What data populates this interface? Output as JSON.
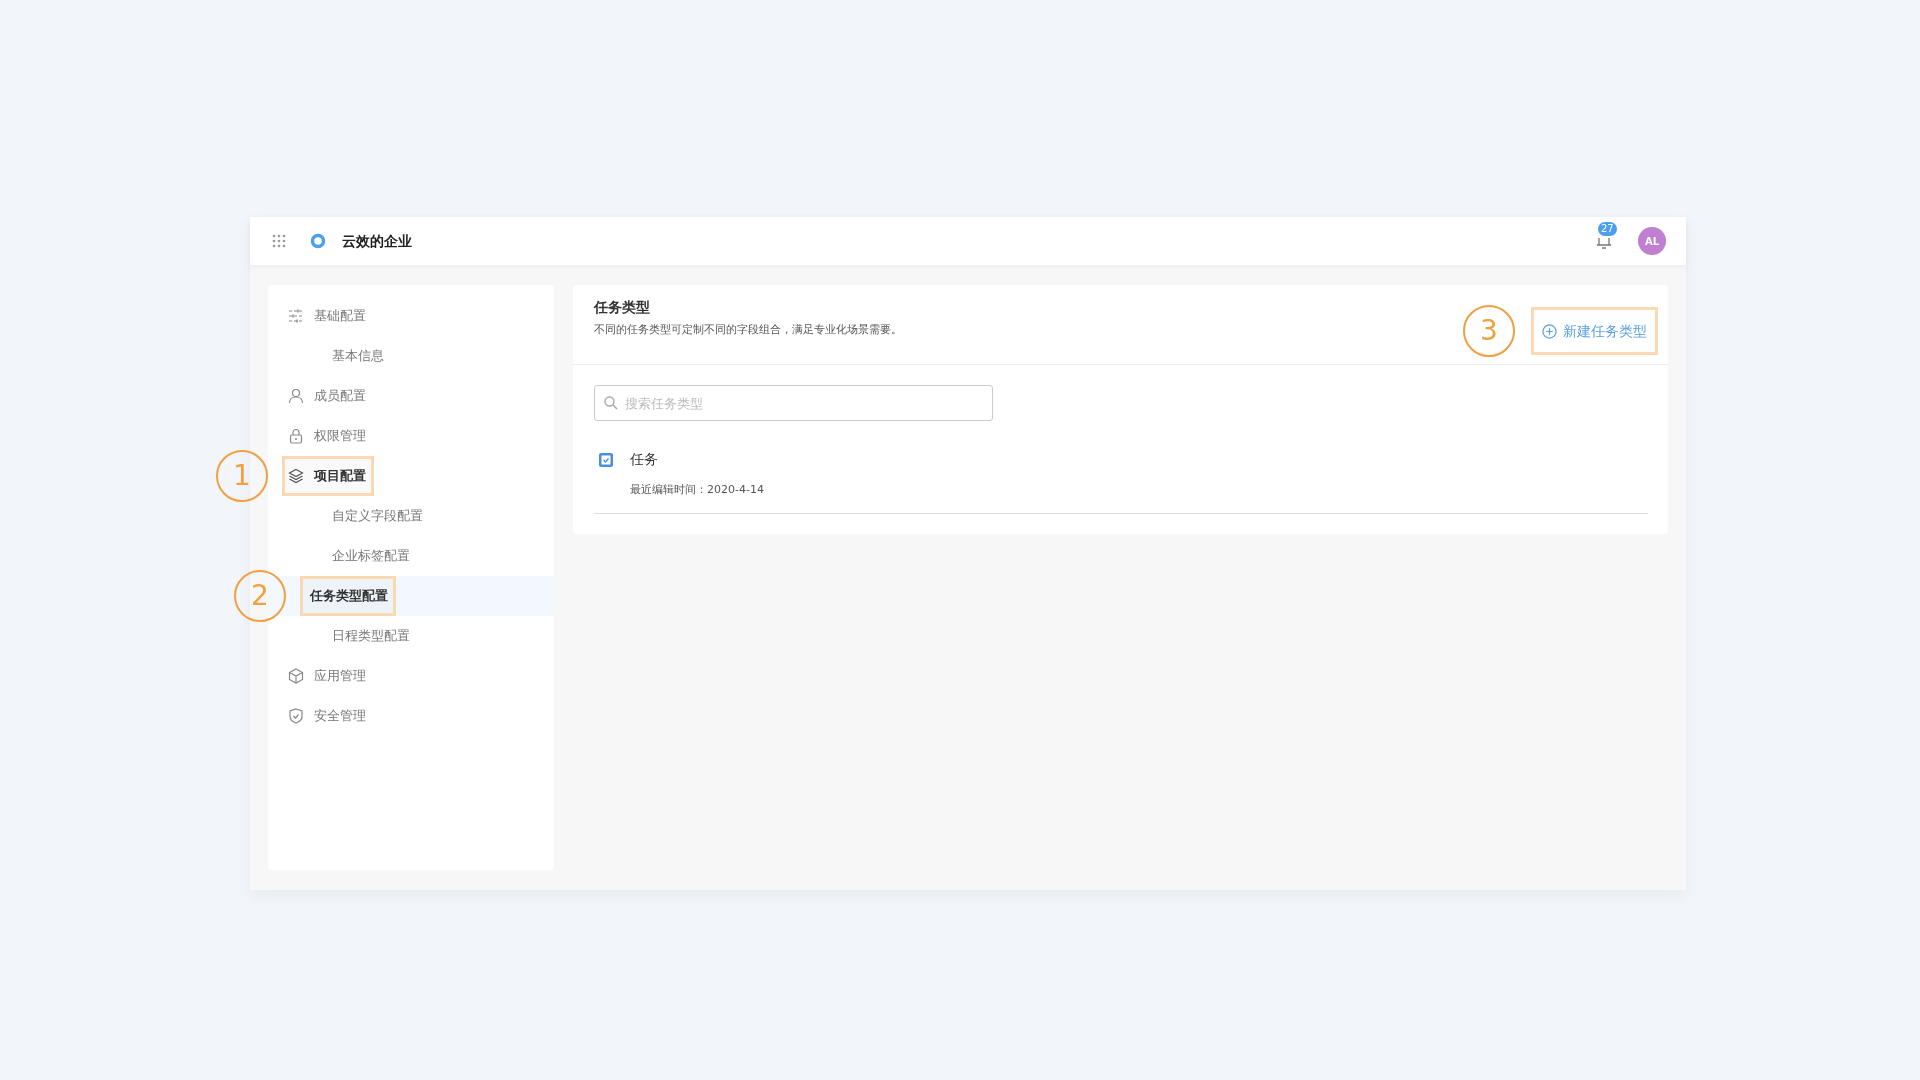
{
  "topbar": {
    "org_name": "云效的企业",
    "notification_count": "27",
    "avatar_initials": "AL"
  },
  "sidebar": {
    "items": [
      {
        "label": "基础配置",
        "active": false,
        "selected": false,
        "children": [
          {
            "label": "基本信息",
            "selected": false
          }
        ]
      },
      {
        "label": "成员配置",
        "active": false,
        "selected": false
      },
      {
        "label": "权限管理",
        "active": false,
        "selected": false
      },
      {
        "label": "项目配置",
        "active": true,
        "selected": false,
        "callout": "1",
        "children": [
          {
            "label": "自定义字段配置",
            "selected": false
          },
          {
            "label": "企业标签配置",
            "selected": false
          },
          {
            "label": "任务类型配置",
            "selected": true,
            "callout": "2"
          },
          {
            "label": "日程类型配置",
            "selected": false
          }
        ]
      },
      {
        "label": "应用管理",
        "active": false,
        "selected": false
      },
      {
        "label": "安全管理",
        "active": false,
        "selected": false
      }
    ]
  },
  "panel": {
    "title": "任务类型",
    "description": "不同的任务类型可定制不同的字段组合，满足专业化场景需要。",
    "new_button": {
      "label": "新建任务类型",
      "callout": "3"
    },
    "search": {
      "placeholder": "搜索任务类型"
    },
    "task_types": [
      {
        "name": "任务",
        "meta": "最近编辑时间：2020-4-14"
      }
    ]
  }
}
